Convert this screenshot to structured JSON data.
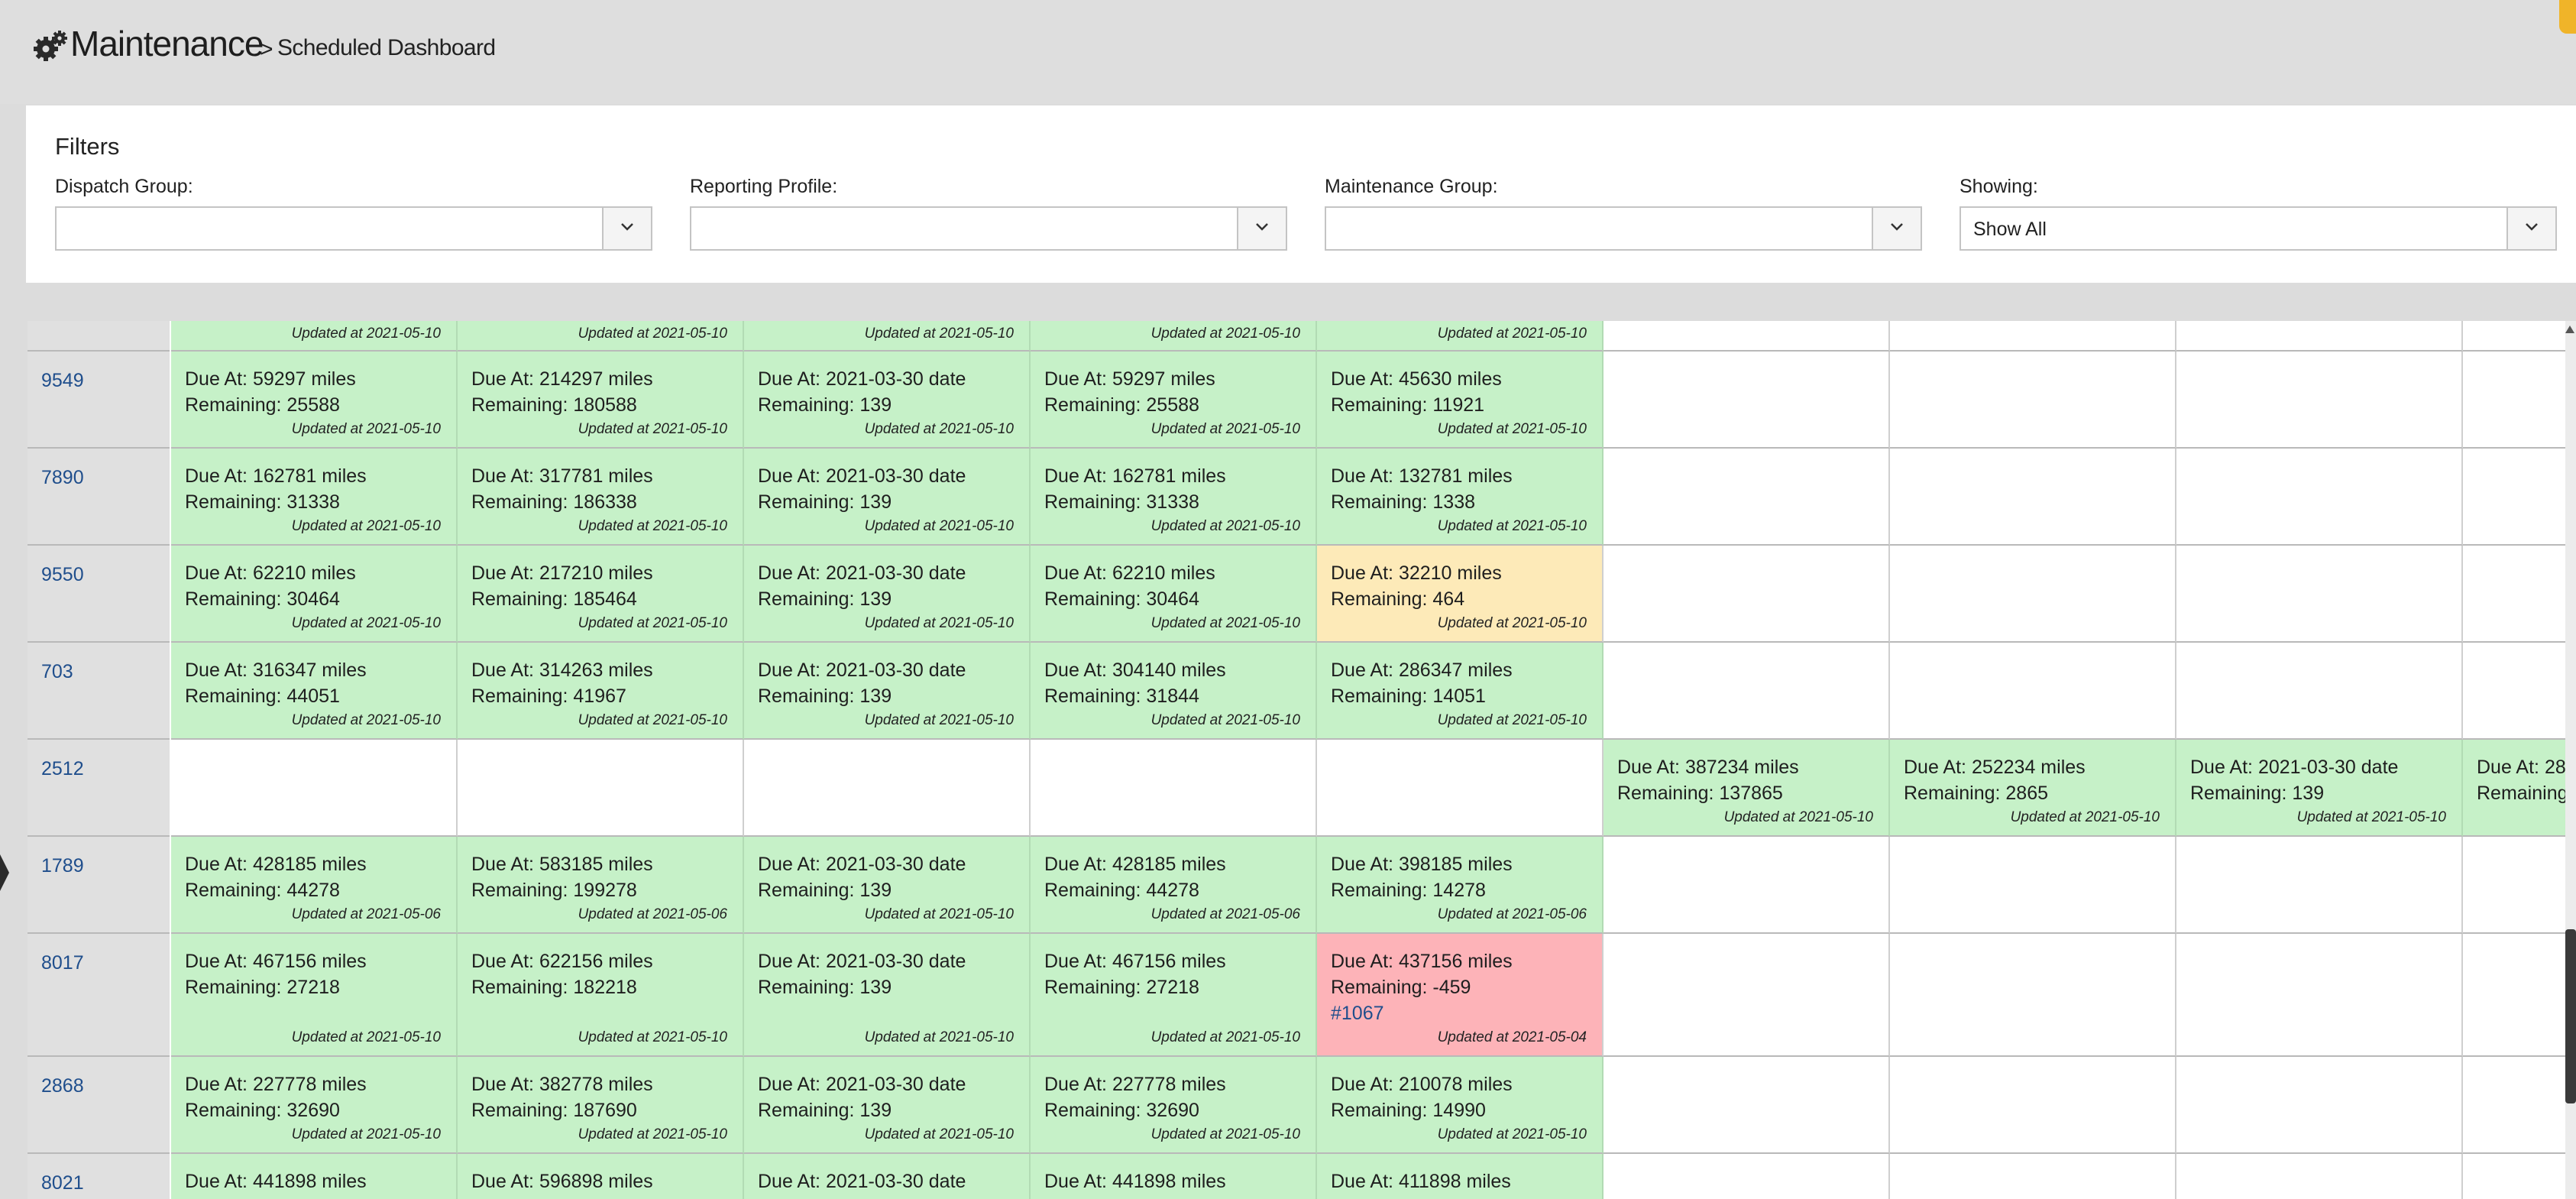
{
  "header": {
    "app_title": "Maintenance",
    "separator": ">",
    "page_title": "Scheduled Dashboard",
    "icon": "gears-icon"
  },
  "filters": {
    "title": "Filters",
    "dispatch_group": {
      "label": "Dispatch Group:",
      "value": ""
    },
    "reporting_profile": {
      "label": "Reporting Profile:",
      "value": ""
    },
    "maintenance_group": {
      "label": "Maintenance Group:",
      "value": ""
    },
    "showing": {
      "label": "Showing:",
      "value": "Show All"
    }
  },
  "colors": {
    "ok": "#c6f1c8",
    "warning": "#fdeab8",
    "overdue": "#fdb3b8",
    "link": "#1f4e8c"
  },
  "top_partial_row": {
    "updated": [
      "Updated at 2021-05-10",
      "Updated at 2021-05-10",
      "Updated at 2021-05-10",
      "Updated at 2021-05-10",
      "Updated at 2021-05-10"
    ]
  },
  "rows": [
    {
      "unit": "9549",
      "cells": [
        {
          "status": "ok",
          "due": "Due At: 59297 miles",
          "remaining": "Remaining: 25588",
          "updated": "Updated at 2021-05-10"
        },
        {
          "status": "ok",
          "due": "Due At: 214297 miles",
          "remaining": "Remaining: 180588",
          "updated": "Updated at 2021-05-10"
        },
        {
          "status": "ok",
          "due": "Due At: 2021-03-30 date",
          "remaining": "Remaining: 139",
          "updated": "Updated at 2021-05-10"
        },
        {
          "status": "ok",
          "due": "Due At: 59297 miles",
          "remaining": "Remaining: 25588",
          "updated": "Updated at 2021-05-10"
        },
        {
          "status": "ok",
          "due": "Due At: 45630 miles",
          "remaining": "Remaining: 11921",
          "updated": "Updated at 2021-05-10"
        },
        null,
        null,
        null,
        null
      ]
    },
    {
      "unit": "7890",
      "cells": [
        {
          "status": "ok",
          "due": "Due At: 162781 miles",
          "remaining": "Remaining: 31338",
          "updated": "Updated at 2021-05-10"
        },
        {
          "status": "ok",
          "due": "Due At: 317781 miles",
          "remaining": "Remaining: 186338",
          "updated": "Updated at 2021-05-10"
        },
        {
          "status": "ok",
          "due": "Due At: 2021-03-30 date",
          "remaining": "Remaining: 139",
          "updated": "Updated at 2021-05-10"
        },
        {
          "status": "ok",
          "due": "Due At: 162781 miles",
          "remaining": "Remaining: 31338",
          "updated": "Updated at 2021-05-10"
        },
        {
          "status": "ok",
          "due": "Due At: 132781 miles",
          "remaining": "Remaining: 1338",
          "updated": "Updated at 2021-05-10"
        },
        null,
        null,
        null,
        null
      ]
    },
    {
      "unit": "9550",
      "cells": [
        {
          "status": "ok",
          "due": "Due At: 62210 miles",
          "remaining": "Remaining: 30464",
          "updated": "Updated at 2021-05-10"
        },
        {
          "status": "ok",
          "due": "Due At: 217210 miles",
          "remaining": "Remaining: 185464",
          "updated": "Updated at 2021-05-10"
        },
        {
          "status": "ok",
          "due": "Due At: 2021-03-30 date",
          "remaining": "Remaining: 139",
          "updated": "Updated at 2021-05-10"
        },
        {
          "status": "ok",
          "due": "Due At: 62210 miles",
          "remaining": "Remaining: 30464",
          "updated": "Updated at 2021-05-10"
        },
        {
          "status": "warning",
          "due": "Due At: 32210 miles",
          "remaining": "Remaining: 464",
          "updated": "Updated at 2021-05-10"
        },
        null,
        null,
        null,
        null
      ]
    },
    {
      "unit": "703",
      "cells": [
        {
          "status": "ok",
          "due": "Due At: 316347 miles",
          "remaining": "Remaining: 44051",
          "updated": "Updated at 2021-05-10"
        },
        {
          "status": "ok",
          "due": "Due At: 314263 miles",
          "remaining": "Remaining: 41967",
          "updated": "Updated at 2021-05-10"
        },
        {
          "status": "ok",
          "due": "Due At: 2021-03-30 date",
          "remaining": "Remaining: 139",
          "updated": "Updated at 2021-05-10"
        },
        {
          "status": "ok",
          "due": "Due At: 304140 miles",
          "remaining": "Remaining: 31844",
          "updated": "Updated at 2021-05-10"
        },
        {
          "status": "ok",
          "due": "Due At: 286347 miles",
          "remaining": "Remaining: 14051",
          "updated": "Updated at 2021-05-10"
        },
        null,
        null,
        null,
        null
      ]
    },
    {
      "unit": "2512",
      "cells": [
        null,
        null,
        null,
        null,
        null,
        {
          "status": "ok",
          "due": "Due At: 387234 miles",
          "remaining": "Remaining: 137865",
          "updated": "Updated at 2021-05-10"
        },
        {
          "status": "ok",
          "due": "Due At: 252234 miles",
          "remaining": "Remaining: 2865",
          "updated": "Updated at 2021-05-10"
        },
        {
          "status": "ok",
          "due": "Due At: 2021-03-30 date",
          "remaining": "Remaining: 139",
          "updated": "Updated at 2021-05-10"
        },
        {
          "status": "ok",
          "due": "Due At: 28",
          "remaining": "Remaining",
          "updated": ""
        }
      ]
    },
    {
      "unit": "1789",
      "cells": [
        {
          "status": "ok",
          "due": "Due At: 428185 miles",
          "remaining": "Remaining: 44278",
          "updated": "Updated at 2021-05-06"
        },
        {
          "status": "ok",
          "due": "Due At: 583185 miles",
          "remaining": "Remaining: 199278",
          "updated": "Updated at 2021-05-06"
        },
        {
          "status": "ok",
          "due": "Due At: 2021-03-30 date",
          "remaining": "Remaining: 139",
          "updated": "Updated at 2021-05-10"
        },
        {
          "status": "ok",
          "due": "Due At: 428185 miles",
          "remaining": "Remaining: 44278",
          "updated": "Updated at 2021-05-06"
        },
        {
          "status": "ok",
          "due": "Due At: 398185 miles",
          "remaining": "Remaining: 14278",
          "updated": "Updated at 2021-05-06"
        },
        null,
        null,
        null,
        null
      ]
    },
    {
      "unit": "8017",
      "cells": [
        {
          "status": "ok",
          "due": "Due At: 467156 miles",
          "remaining": "Remaining: 27218",
          "updated": "Updated at 2021-05-10"
        },
        {
          "status": "ok",
          "due": "Due At: 622156 miles",
          "remaining": "Remaining: 182218",
          "updated": "Updated at 2021-05-10"
        },
        {
          "status": "ok",
          "due": "Due At: 2021-03-30 date",
          "remaining": "Remaining: 139",
          "updated": "Updated at 2021-05-10"
        },
        {
          "status": "ok",
          "due": "Due At: 467156 miles",
          "remaining": "Remaining: 27218",
          "updated": "Updated at 2021-05-10"
        },
        {
          "status": "overdue",
          "due": "Due At: 437156 miles",
          "remaining": "Remaining: -459",
          "work_order": "#1067",
          "updated": "Updated at 2021-05-04"
        },
        null,
        null,
        null,
        null
      ]
    },
    {
      "unit": "2868",
      "cells": [
        {
          "status": "ok",
          "due": "Due At: 227778 miles",
          "remaining": "Remaining: 32690",
          "updated": "Updated at 2021-05-10"
        },
        {
          "status": "ok",
          "due": "Due At: 382778 miles",
          "remaining": "Remaining: 187690",
          "updated": "Updated at 2021-05-10"
        },
        {
          "status": "ok",
          "due": "Due At: 2021-03-30 date",
          "remaining": "Remaining: 139",
          "updated": "Updated at 2021-05-10"
        },
        {
          "status": "ok",
          "due": "Due At: 227778 miles",
          "remaining": "Remaining: 32690",
          "updated": "Updated at 2021-05-10"
        },
        {
          "status": "ok",
          "due": "Due At: 210078 miles",
          "remaining": "Remaining: 14990",
          "updated": "Updated at 2021-05-10"
        },
        null,
        null,
        null,
        null
      ]
    },
    {
      "unit": "8021",
      "cells": [
        {
          "status": "ok",
          "due": "Due At: 441898 miles",
          "remaining": "",
          "updated": ""
        },
        {
          "status": "ok",
          "due": "Due At: 596898 miles",
          "remaining": "",
          "updated": ""
        },
        {
          "status": "ok",
          "due": "Due At: 2021-03-30 date",
          "remaining": "",
          "updated": ""
        },
        {
          "status": "ok",
          "due": "Due At: 441898 miles",
          "remaining": "",
          "updated": ""
        },
        {
          "status": "ok",
          "due": "Due At: 411898 miles",
          "remaining": "",
          "updated": ""
        },
        null,
        null,
        null,
        null
      ]
    }
  ]
}
